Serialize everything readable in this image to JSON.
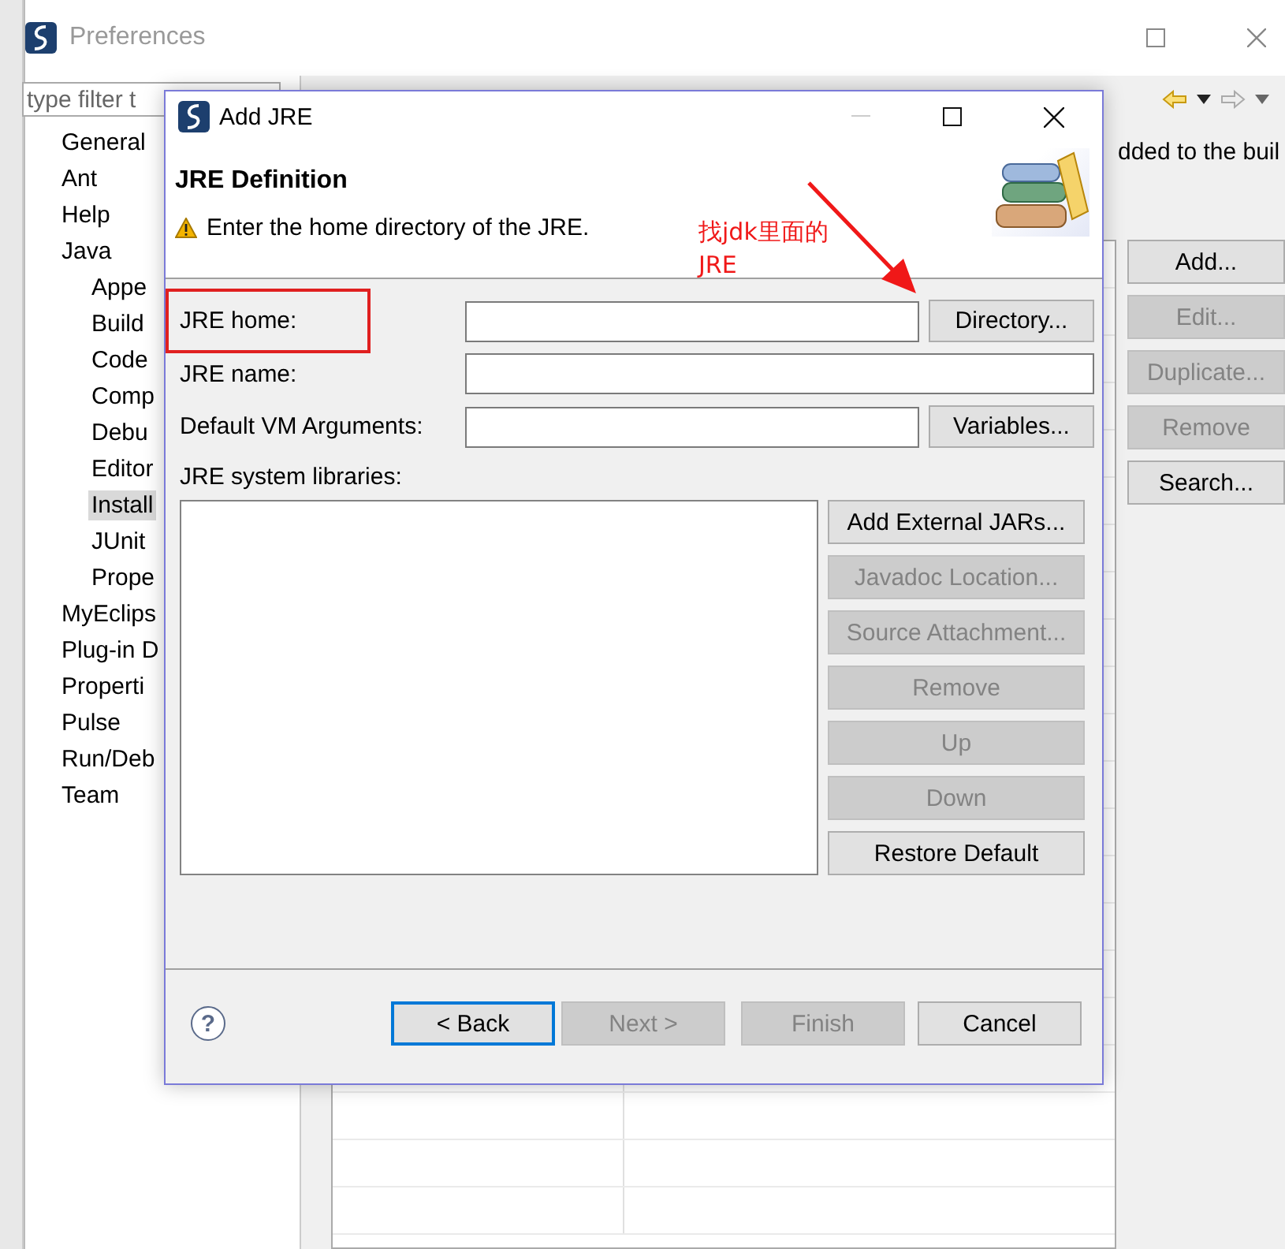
{
  "preferences": {
    "title": "Preferences",
    "filter": {
      "placeholder": "type filter t"
    },
    "tree": [
      {
        "label": "General",
        "selected": false
      },
      {
        "label": "Ant",
        "selected": false
      },
      {
        "label": "Help",
        "selected": false
      },
      {
        "label": "Java",
        "selected": false,
        "children": [
          {
            "label": "Appe",
            "selected": false
          },
          {
            "label": "Build",
            "selected": false
          },
          {
            "label": "Code",
            "selected": false
          },
          {
            "label": "Comp",
            "selected": false
          },
          {
            "label": "Debu",
            "selected": false
          },
          {
            "label": "Editor",
            "selected": false
          },
          {
            "label": "Install",
            "selected": true
          },
          {
            "label": "JUnit",
            "selected": false
          },
          {
            "label": "Prope",
            "selected": false
          }
        ]
      },
      {
        "label": "MyEclips",
        "selected": false
      },
      {
        "label": "Plug-in D",
        "selected": false
      },
      {
        "label": "Properti",
        "selected": false
      },
      {
        "label": "Pulse",
        "selected": false
      },
      {
        "label": "Run/Deb",
        "selected": false
      },
      {
        "label": "Team",
        "selected": false
      }
    ],
    "description": "dded to the buil",
    "side_buttons": [
      {
        "label": "Add...",
        "disabled": false
      },
      {
        "label": "Edit...",
        "disabled": true
      },
      {
        "label": "Duplicate...",
        "disabled": true
      },
      {
        "label": "Remove",
        "disabled": true
      },
      {
        "label": "Search...",
        "disabled": false
      }
    ]
  },
  "dialog": {
    "title": "Add JRE",
    "heading": "JRE Definition",
    "message": "Enter the home directory of the JRE.",
    "fields": [
      {
        "label": "JRE home:",
        "button": "Directory..."
      },
      {
        "label": "JRE name:"
      },
      {
        "label": "Default VM Arguments:",
        "button": "Variables..."
      }
    ],
    "libraries_label": "JRE system libraries:",
    "library_buttons": [
      {
        "label": "Add External JARs...",
        "disabled": false
      },
      {
        "label": "Javadoc Location...",
        "disabled": true
      },
      {
        "label": "Source Attachment...",
        "disabled": true
      },
      {
        "label": "Remove",
        "disabled": true
      },
      {
        "label": "Up",
        "disabled": true
      },
      {
        "label": "Down",
        "disabled": true
      },
      {
        "label": "Restore Default",
        "disabled": false
      }
    ],
    "footer_buttons": [
      {
        "label": "< Back",
        "disabled": false,
        "default": true
      },
      {
        "label": "Next >",
        "disabled": true,
        "default": false
      },
      {
        "label": "Finish",
        "disabled": true,
        "default": false
      },
      {
        "label": "Cancel",
        "disabled": false,
        "default": false
      }
    ],
    "help": "?"
  },
  "annotation": {
    "lines": [
      "找jdk里面的",
      "JRE"
    ]
  }
}
